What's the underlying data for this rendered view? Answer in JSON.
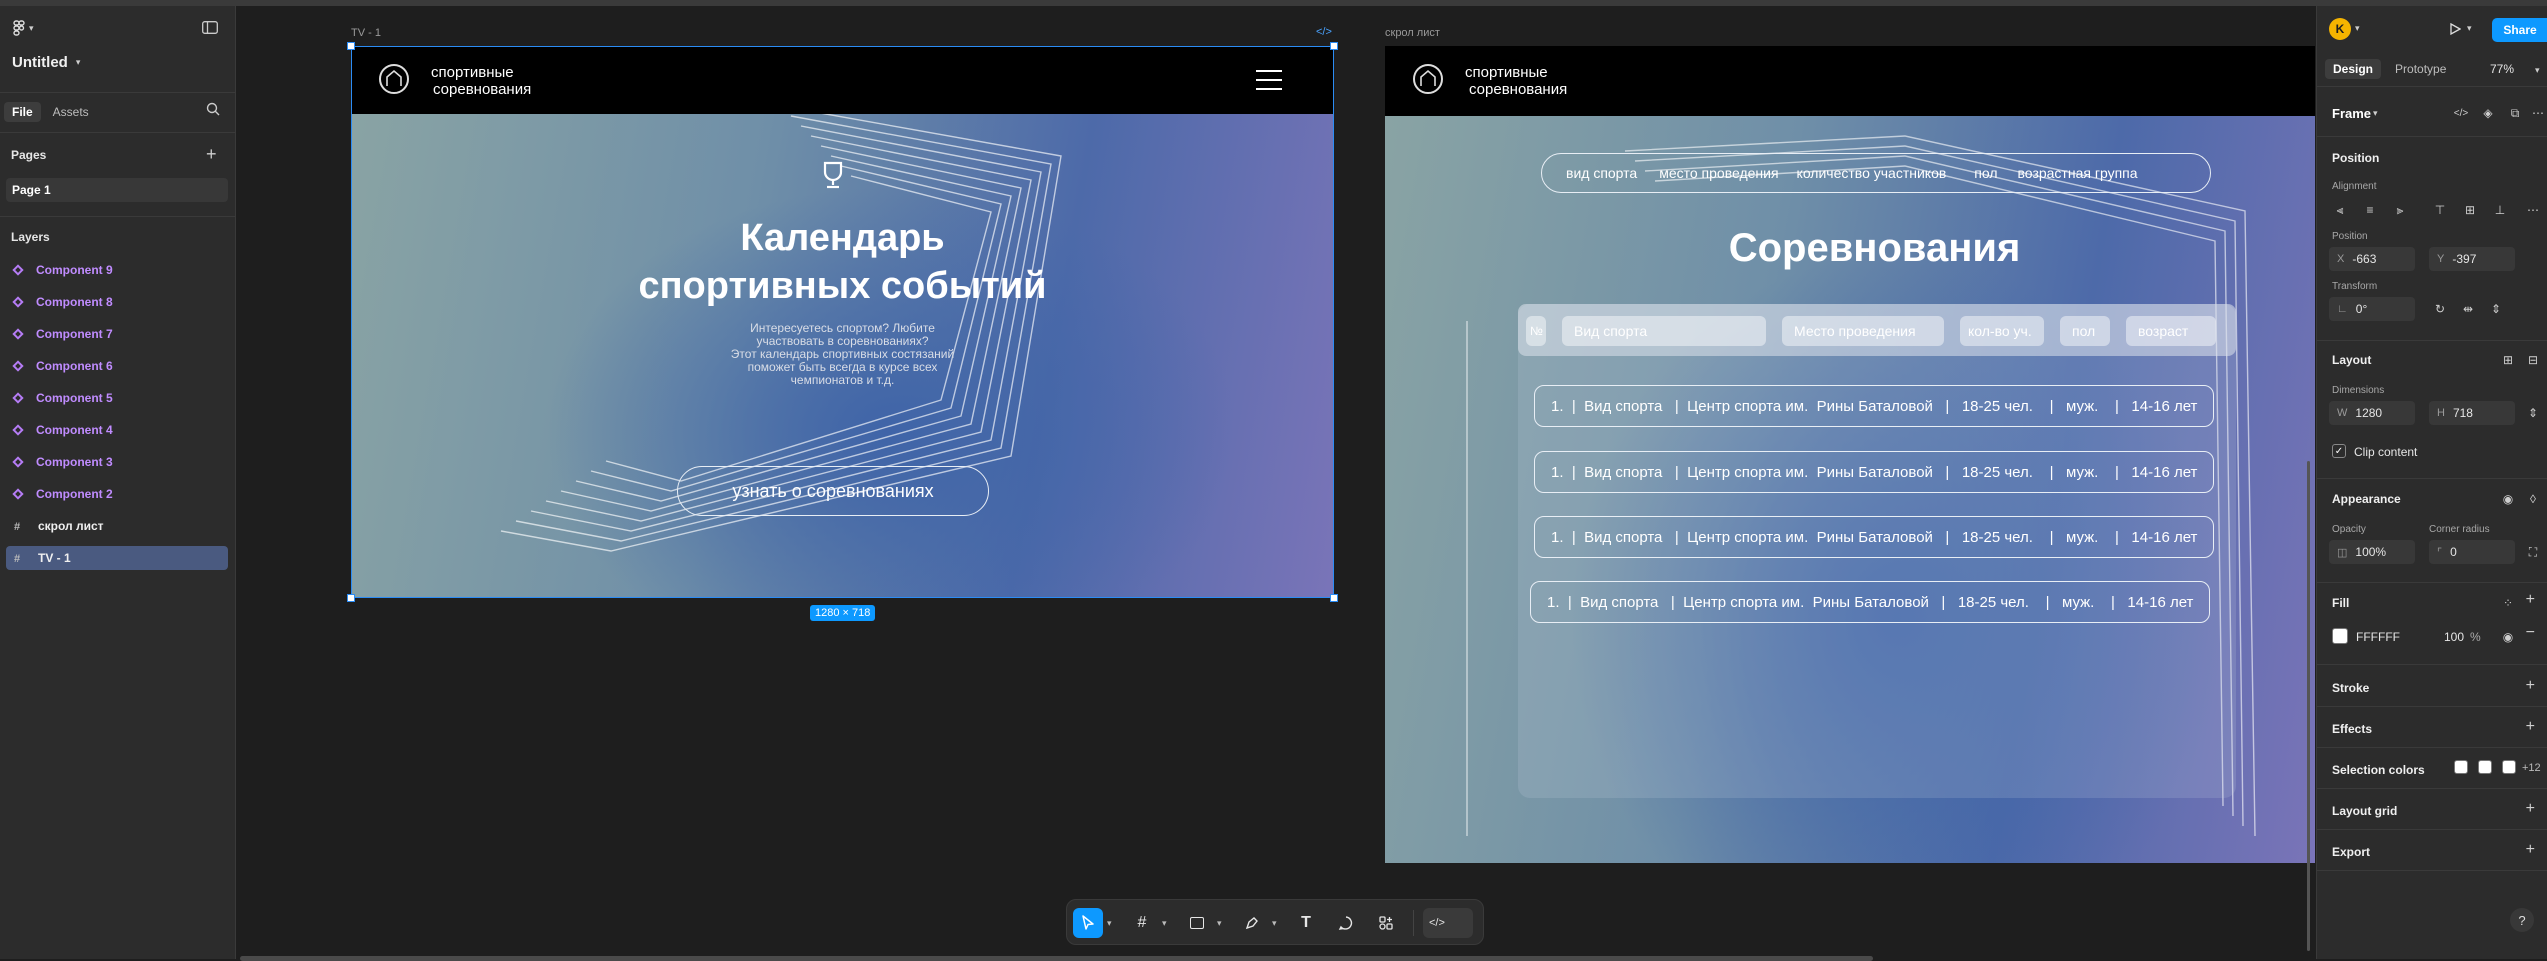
{
  "left_panel": {
    "file_name": "Untitled",
    "tabs": [
      "File",
      "Assets"
    ],
    "pages_title": "Pages",
    "pages": [
      "Page 1"
    ],
    "layers_title": "Layers",
    "layers": [
      {
        "name": "Component 9",
        "kind": "component"
      },
      {
        "name": "Component 8",
        "kind": "component"
      },
      {
        "name": "Component 7",
        "kind": "component"
      },
      {
        "name": "Component 6",
        "kind": "component"
      },
      {
        "name": "Component 5",
        "kind": "component"
      },
      {
        "name": "Component 4",
        "kind": "component"
      },
      {
        "name": "Component 3",
        "kind": "component"
      },
      {
        "name": "Component 2",
        "kind": "component"
      },
      {
        "name": "скрол лист",
        "kind": "frame"
      },
      {
        "name": "TV - 1",
        "kind": "frame",
        "selected": true
      }
    ]
  },
  "canvas": {
    "frame1": {
      "label": "TV - 1",
      "code_icon": "code-icon",
      "brand_line1": "спортивные",
      "brand_line2": "соревнования",
      "title_line1": "Календарь",
      "title_line2": "спортивных событий",
      "desc_line1": "Интересуетесь спортом? Любите",
      "desc_line2": "участвовать в соревнованиях?",
      "desc_line3": "Этот календарь спортивных состязаний",
      "desc_line4": "поможет быть всегда в курсе всех",
      "desc_line5": "чемпионатов и т.д.",
      "cta": "узнать о соревнованиях",
      "dimensions": "1280 × 718"
    },
    "frame2": {
      "label": "скрол лист",
      "brand_line1": "спортивные",
      "brand_line2": "соревнования",
      "nav_items": [
        "вид спорта",
        "место проведения",
        "количество участников",
        "пол",
        "возрастная группа"
      ],
      "title": "Соревнования",
      "filters": [
        "Вид спорта",
        "Место проведения",
        "кол-во уч.",
        "пол",
        "возраст"
      ],
      "filter_first": "№",
      "rows": [
        "1.  |  Вид спорта   |  Центр спорта им.  Рины Баталовой   |   18-25 чел.    |   муж.    |   14-16 лет",
        "1.  |  Вид спорта   |  Центр спорта им.  Рины Баталовой   |   18-25 чел.    |   муж.    |   14-16 лет",
        "1.  |  Вид спорта   |  Центр спорта им.  Рины Баталовой   |   18-25 чел.    |   муж.    |   14-16 лет",
        "1.  |  Вид спорта   |  Центр спорта им.  Рины Баталовой   |   18-25 чел.    |   муж.    |   14-16 лет"
      ]
    }
  },
  "toolbar": {
    "tools": [
      "move-tool",
      "frame-tool",
      "rectangle-tool",
      "pen-tool",
      "text-tool",
      "comment-tool",
      "actions-tool",
      "dev-mode-toggle"
    ]
  },
  "right_panel": {
    "avatar_letter": "K",
    "share": "Share",
    "tabs": [
      "Design",
      "Prototype"
    ],
    "zoom": "77%",
    "frame_label": "Frame",
    "position_title": "Position",
    "alignment_label": "Alignment",
    "position_label": "Position",
    "x_label": "X",
    "x_value": "-663",
    "y_label": "Y",
    "y_value": "-397",
    "transform_label": "Transform",
    "rotation_value": "0°",
    "layout_title": "Layout",
    "dimensions_label": "Dimensions",
    "w_label": "W",
    "w_value": "1280",
    "h_label": "H",
    "h_value": "718",
    "clip_content": "Clip content",
    "appearance_title": "Appearance",
    "opacity_label": "Opacity",
    "opacity_value": "100%",
    "corner_label": "Corner radius",
    "corner_value": "0",
    "fill_title": "Fill",
    "fill_hex": "FFFFFF",
    "fill_opacity": "100",
    "fill_unit": "%",
    "stroke_title": "Stroke",
    "effects_title": "Effects",
    "selection_colors_title": "Selection colors",
    "selection_colors_more": "+12",
    "layout_grid_title": "Layout grid",
    "export_title": "Export",
    "help": "?"
  }
}
